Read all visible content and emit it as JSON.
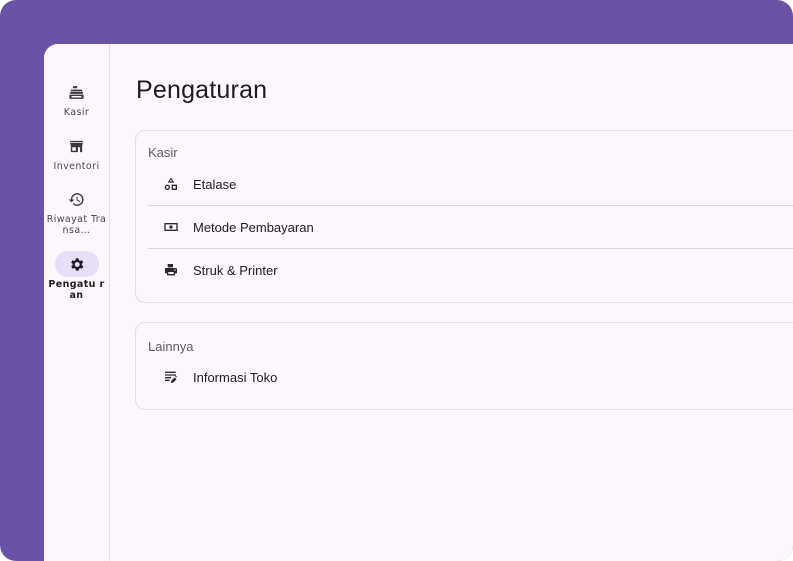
{
  "app": {
    "page_title": "Pengaturan"
  },
  "nav": {
    "items": [
      {
        "label": "Kasir",
        "icon": "cash-register-icon",
        "active": false
      },
      {
        "label": "Inventori",
        "icon": "store-icon",
        "active": false
      },
      {
        "label": "Riwayat Transa…",
        "icon": "history-icon",
        "active": false
      },
      {
        "label": "Pengatu ran",
        "icon": "gear-icon",
        "active": true
      }
    ]
  },
  "sections": [
    {
      "title": "Kasir",
      "items": [
        {
          "label": "Etalase",
          "icon": "shapes-icon"
        },
        {
          "label": "Metode Pembayaran",
          "icon": "money-icon"
        },
        {
          "label": "Struk & Printer",
          "icon": "printer-icon"
        }
      ]
    },
    {
      "title": "Lainnya",
      "items": [
        {
          "label": "Informasi Toko",
          "icon": "store-info-icon"
        }
      ]
    }
  ],
  "colors": {
    "frame": "#6a52a6",
    "surface": "#fdf7fd",
    "active_indicator": "#e8def8"
  }
}
